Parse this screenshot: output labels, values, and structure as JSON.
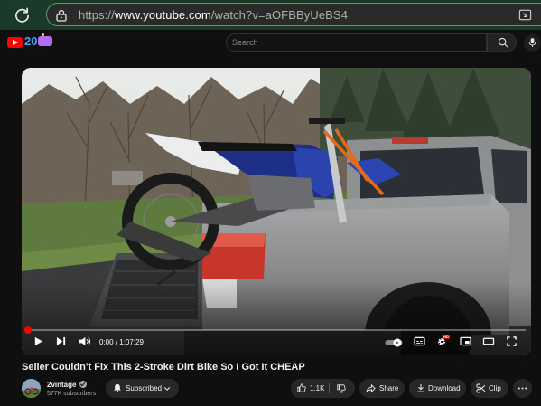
{
  "browser": {
    "url_prefix": "https://",
    "url_host": "www.youtube.com",
    "url_path": "/watch?v=aOFBByUeBS4"
  },
  "header": {
    "logo_badge": "20",
    "search_placeholder": "Search"
  },
  "player": {
    "time_current": "0:00",
    "time_total": "1:07:29",
    "progress_fraction": 0.0,
    "hd_badge": "HD"
  },
  "video": {
    "title": "Seller Couldn't Fix This 2-Stroke Dirt Bike So I Got It CHEAP"
  },
  "channel": {
    "name": "2vintage",
    "subscribers": "577K subscribers"
  },
  "actions": {
    "subscribed_label": "Subscribed",
    "like_count": "1.1K",
    "share_label": "Share",
    "download_label": "Download",
    "clip_label": "Clip"
  },
  "colors": {
    "accent_red": "#ff0000",
    "url_bar_border": "#4fa070"
  }
}
